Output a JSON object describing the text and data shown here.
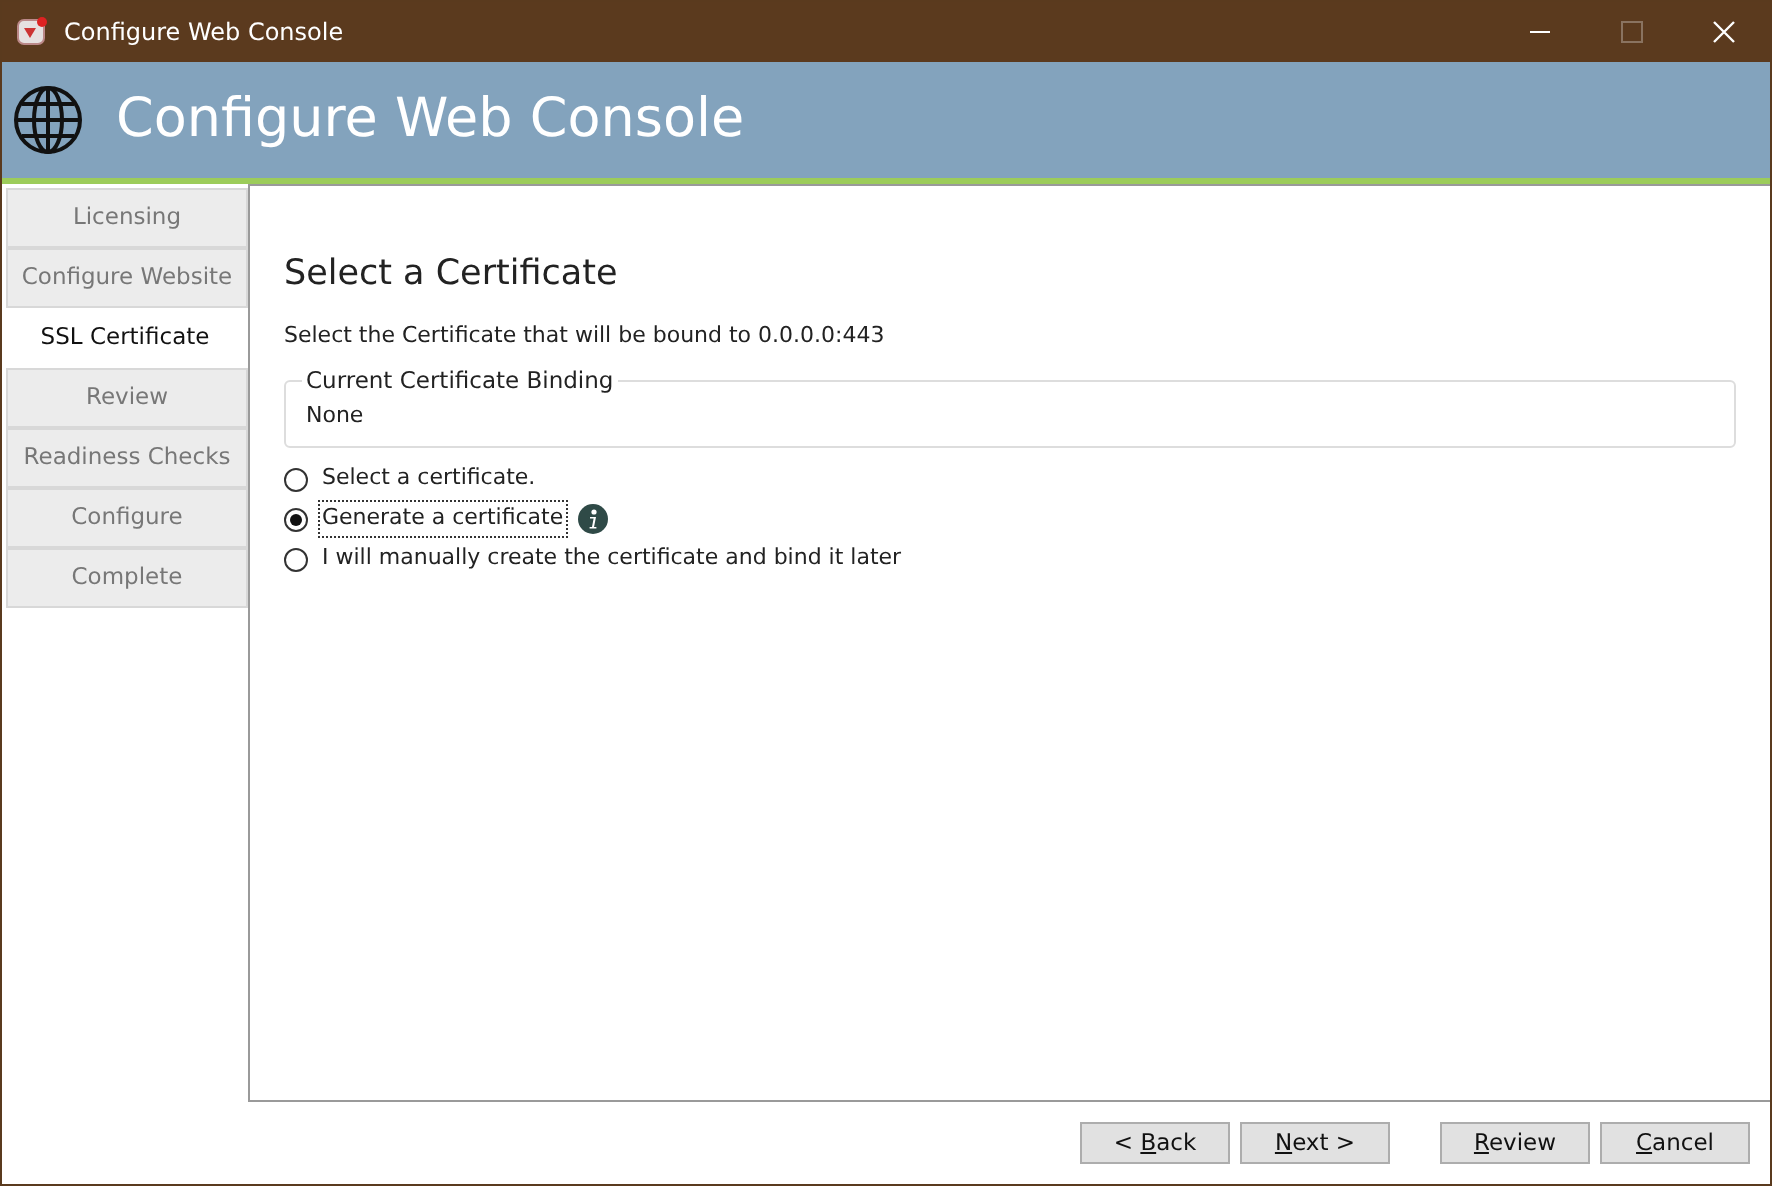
{
  "window": {
    "title": "Configure Web Console",
    "maximize_disabled": true
  },
  "header": {
    "title": "Configure Web Console"
  },
  "steps": [
    {
      "label": "Licensing",
      "selected": false
    },
    {
      "label": "Configure Website",
      "selected": false
    },
    {
      "label": "SSL Certificate",
      "selected": true
    },
    {
      "label": "Review",
      "selected": false
    },
    {
      "label": "Readiness Checks",
      "selected": false
    },
    {
      "label": "Configure",
      "selected": false
    },
    {
      "label": "Complete",
      "selected": false
    }
  ],
  "page": {
    "heading": "Select a Certificate",
    "description": "Select the Certificate that will be bound to 0.0.0.0:443",
    "binding": {
      "legend": "Current Certificate Binding",
      "value": "None"
    },
    "options": [
      {
        "label": "Select a certificate.",
        "selected": false,
        "focused": false,
        "info": false
      },
      {
        "label": "Generate a certificate",
        "selected": true,
        "focused": true,
        "info": true
      },
      {
        "label": "I will manually create the certificate and bind it later",
        "selected": false,
        "focused": false,
        "info": false
      }
    ]
  },
  "button_groups": [
    {
      "buttons": [
        {
          "before_key": "< ",
          "access_key": "B",
          "after_key": "ack"
        },
        {
          "access_key": "N",
          "after_key": "ext >"
        }
      ]
    },
    {
      "buttons": [
        {
          "access_key": "R",
          "after_key": "eview"
        },
        {
          "access_key": "C",
          "after_key": "ancel"
        }
      ]
    }
  ]
}
